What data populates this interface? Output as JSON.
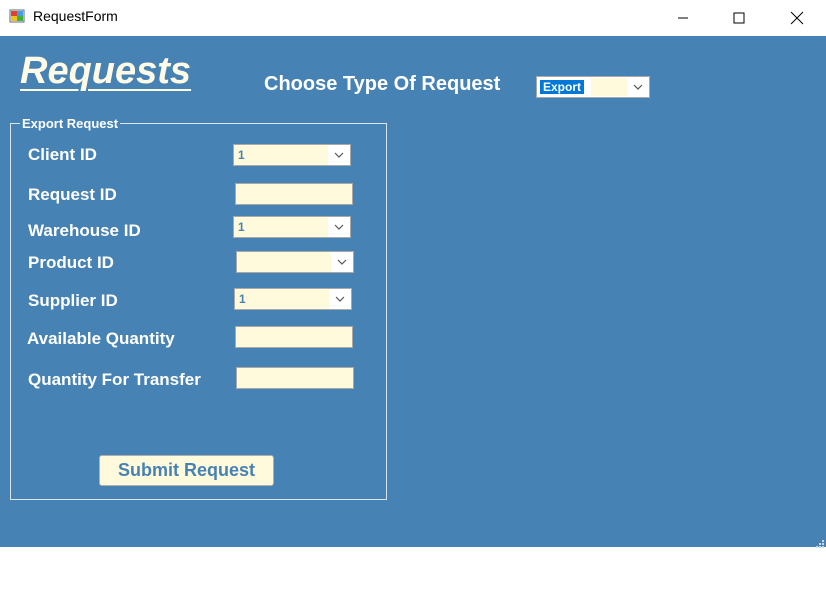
{
  "window": {
    "title": "RequestForm"
  },
  "heading": "Requests",
  "type_selector": {
    "label": "Choose Type Of Request",
    "value": "Export"
  },
  "group": {
    "title": "Export Request",
    "fields": {
      "client_id": {
        "label": "Client ID",
        "value": "1"
      },
      "request_id": {
        "label": "Request ID",
        "value": ""
      },
      "warehouse_id": {
        "label": "Warehouse ID",
        "value": "1"
      },
      "product_id": {
        "label": "Product ID",
        "value": ""
      },
      "supplier_id": {
        "label": "Supplier ID",
        "value": "1"
      },
      "available_quantity": {
        "label": "Available Quantity",
        "value": ""
      },
      "quantity_for_transfer": {
        "label": "Quantity For Transfer",
        "value": ""
      }
    }
  },
  "submit_label": "Submit Request",
  "colors": {
    "background": "#4682b4",
    "input_fill": "#fffadc",
    "label": "#ffffff"
  }
}
